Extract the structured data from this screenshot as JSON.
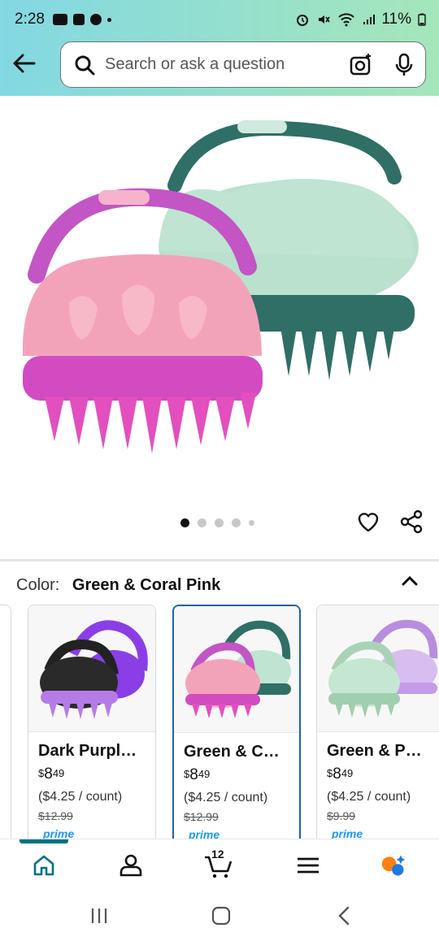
{
  "status_bar": {
    "time": "2:28",
    "battery": "11%"
  },
  "search": {
    "placeholder": "Search or ask a question"
  },
  "product_image": {
    "carousel_active_index": 0,
    "carousel_count": 5
  },
  "color": {
    "label": "Color:",
    "selected": "Green & Coral Pink"
  },
  "variants": [
    {
      "name": "Dark Purpl…",
      "price_dollars": "8",
      "price_cents": "49",
      "unit_price": "($4.25 / count)",
      "was_price": "$12.99",
      "badge": "prime"
    },
    {
      "name": "Green & C…",
      "price_dollars": "8",
      "price_cents": "49",
      "unit_price": "($4.25 / count)",
      "was_price": "$12.99",
      "badge": "prime"
    },
    {
      "name": "Green & P…",
      "price_dollars": "8",
      "price_cents": "49",
      "unit_price": "($4.25 / count)",
      "was_price": "$9.99",
      "badge": "prime"
    }
  ],
  "price_symbol": "$",
  "bottom_nav": {
    "cart_count": "12"
  },
  "colors": {
    "accent_teal": "#007185",
    "selected_border": "#2162a1",
    "prime_blue": "#1a98ff"
  }
}
